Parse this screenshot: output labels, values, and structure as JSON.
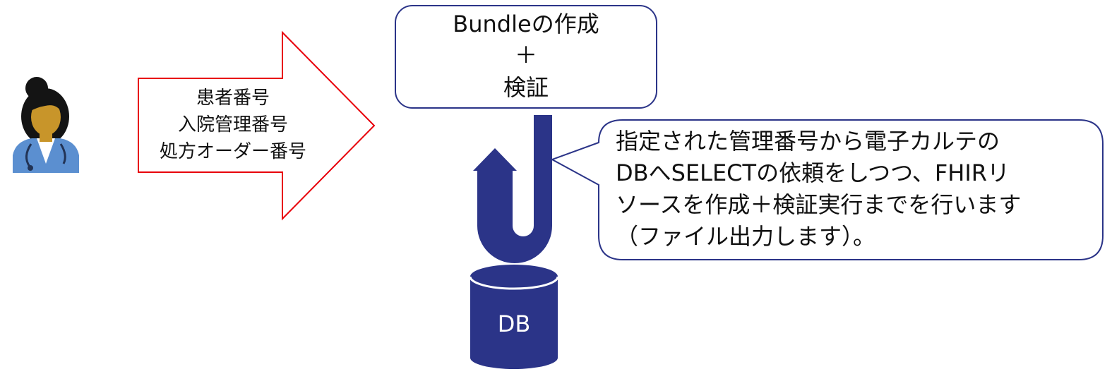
{
  "input_arrow": {
    "lines": [
      "患者番号",
      "入院管理番号",
      "処方オーダー番号"
    ]
  },
  "process_box": {
    "line1": "Bundleの作成",
    "line2": "＋",
    "line3": "検証"
  },
  "callout": {
    "lines": [
      "指定された管理番号から電子カルテの",
      "DBへSELECTの依頼をしつつ、FHIRリ",
      "ソースを作成＋検証実行までを行います",
      "（ファイル出力します）。"
    ]
  },
  "database": {
    "label": "DB"
  },
  "colors": {
    "arrow_outline": "#e8000b",
    "box_border": "#2b3488",
    "flow_arrow": "#2b3488",
    "db_fill": "#2b3488",
    "skin": "#c8952a",
    "coat": "#5b8fd0"
  }
}
